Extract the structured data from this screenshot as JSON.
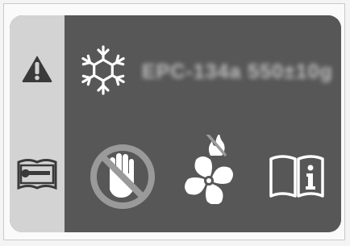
{
  "label": {
    "text": "EPC-134a 550±10g"
  },
  "icons": {
    "warning": "warning-triangle-icon",
    "service_manual": "service-manual-icon",
    "refrigerant": "snowflake-icon",
    "no_touch": "no-touch-hand-icon",
    "fan_no_flammable": "fan-no-flammable-icon",
    "read_manual": "read-manual-info-icon"
  },
  "colors": {
    "panel": "#575757",
    "sidebar": "#d3d3d3",
    "symbol_white": "#ffffff",
    "prohibition": "#9a9a9a"
  }
}
